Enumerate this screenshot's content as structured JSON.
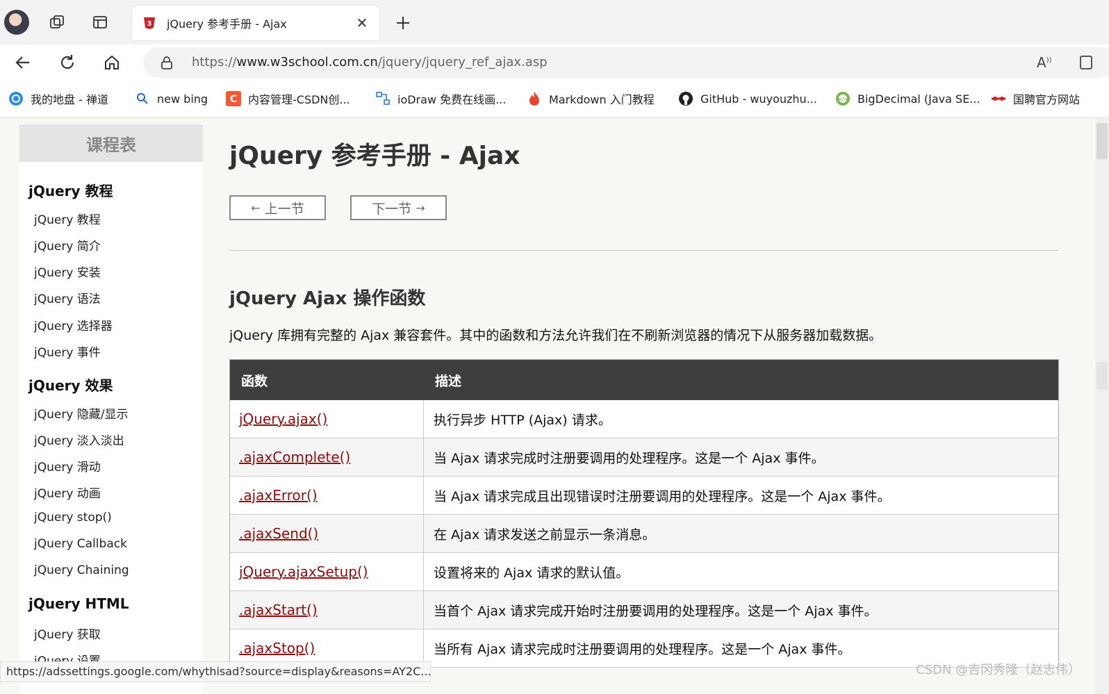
{
  "tab": {
    "title": "jQuery 参考手册 - Ajax",
    "close": "✕"
  },
  "address": {
    "prefix": "https://",
    "host": "www.w3school.com.cn",
    "path": "/jquery/jquery_ref_ajax.asp"
  },
  "bookmarks": [
    {
      "label": "我的地盘 - 禅道",
      "icon": "zentao-icon"
    },
    {
      "label": "new bing",
      "icon": "search-icon"
    },
    {
      "label": "内容管理-CSDN创...",
      "icon": "csdn-icon"
    },
    {
      "label": "ioDraw 免费在线画...",
      "icon": "iodraw-icon"
    },
    {
      "label": "Markdown 入门教程",
      "icon": "flame-icon"
    },
    {
      "label": "GitHub - wuyouzhu...",
      "icon": "github-icon"
    },
    {
      "label": "BigDecimal (Java SE...",
      "icon": "java-icon"
    },
    {
      "label": "国聘官方网站",
      "icon": "guopin-icon"
    }
  ],
  "sidebar": {
    "header": "课程表",
    "categories": [
      {
        "title": "jQuery 教程",
        "items": [
          "jQuery 教程",
          "jQuery 简介",
          "jQuery 安装",
          "jQuery 语法",
          "jQuery 选择器",
          "jQuery 事件"
        ]
      },
      {
        "title": "jQuery 效果",
        "items": [
          "jQuery 隐藏/显示",
          "jQuery 淡入淡出",
          "jQuery 滑动",
          "jQuery 动画",
          "jQuery stop()",
          "jQuery Callback",
          "jQuery Chaining"
        ]
      },
      {
        "title": "jQuery HTML",
        "items": [
          "jQuery 获取",
          "jQuery 设置"
        ]
      }
    ]
  },
  "main": {
    "title": "jQuery 参考手册 - Ajax",
    "prev": "上一节",
    "next": "下一节",
    "section_title": "jQuery Ajax 操作函数",
    "intro": "jQuery 库拥有完整的 Ajax 兼容套件。其中的函数和方法允许我们在不刷新浏览器的情况下从服务器加载数据。",
    "table": {
      "headers": [
        "函数",
        "描述"
      ],
      "rows": [
        {
          "fn": "jQuery.ajax()",
          "desc": "执行异步 HTTP (Ajax) 请求。"
        },
        {
          "fn": ".ajaxComplete()",
          "desc": "当 Ajax 请求完成时注册要调用的处理程序。这是一个 Ajax 事件。"
        },
        {
          "fn": ".ajaxError()",
          "desc": "当 Ajax 请求完成且出现错误时注册要调用的处理程序。这是一个 Ajax 事件。"
        },
        {
          "fn": ".ajaxSend()",
          "desc": "在 Ajax 请求发送之前显示一条消息。"
        },
        {
          "fn": "jQuery.ajaxSetup()",
          "desc": "设置将来的 Ajax 请求的默认值。"
        },
        {
          "fn": ".ajaxStart()",
          "desc": "当首个 Ajax 请求完成开始时注册要调用的处理程序。这是一个 Ajax 事件。"
        },
        {
          "fn": ".ajaxStop()",
          "desc": "当所有 Ajax 请求完成时注册要调用的处理程序。这是一个 Ajax 事件。"
        }
      ]
    }
  },
  "status_url": "https://adssettings.google.com/whythisad?source=display&reasons=AY2C...",
  "watermark": "CSDN @吉冈秀隆（赵志伟）",
  "colors": {
    "link": "#900b09",
    "table_header_bg": "#3e3e3e",
    "sidebar_header_bg": "#e4e4e4"
  }
}
